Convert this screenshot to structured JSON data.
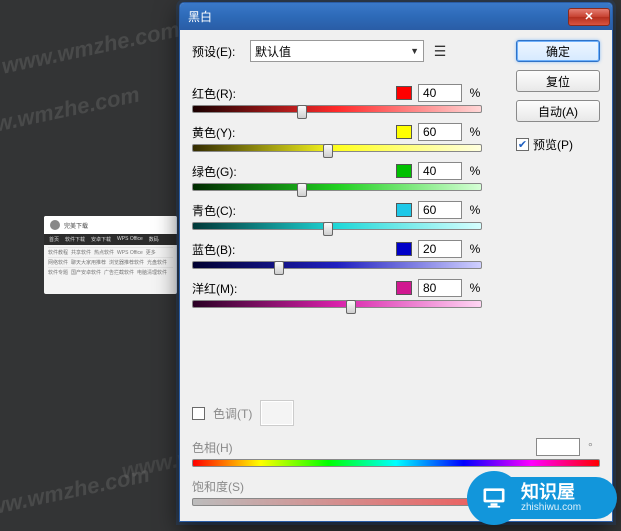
{
  "watermark": "www.wmzhe.com",
  "webpage": {
    "title": "完美下载",
    "tabs": [
      "首页",
      "软件下载",
      "安卓下载",
      "WPS Office",
      "数码"
    ],
    "rows": [
      [
        "软件教程",
        "共享软件",
        "热点软件",
        "WPS Office",
        "更多"
      ],
      [
        "网络软件",
        "聊天大家用推荐",
        "浏览器推荐软件",
        "光盘软件"
      ],
      [
        "软件专题",
        "国产安卓软件",
        "广告拦截软件",
        "电脑清理软件"
      ]
    ]
  },
  "dialog": {
    "title": "黑白",
    "preset_label": "预设(E):",
    "preset_value": "默认值",
    "buttons": {
      "ok": "确定",
      "reset": "复位",
      "auto": "自动(A)"
    },
    "preview_label": "预览(P)",
    "preview_checked": true,
    "colors": [
      {
        "key": "red",
        "label": "红色(R):",
        "swatch": "#ff0000",
        "value": "40",
        "thumbPct": 38
      },
      {
        "key": "yellow",
        "label": "黄色(Y):",
        "swatch": "#ffff00",
        "value": "60",
        "thumbPct": 47
      },
      {
        "key": "green",
        "label": "绿色(G):",
        "swatch": "#00c000",
        "value": "40",
        "thumbPct": 38
      },
      {
        "key": "cyan",
        "label": "青色(C):",
        "swatch": "#1ec8e8",
        "value": "60",
        "thumbPct": 47
      },
      {
        "key": "blue",
        "label": "蓝色(B):",
        "swatch": "#0000c8",
        "value": "20",
        "thumbPct": 30
      },
      {
        "key": "magenta",
        "label": "洋红(M):",
        "swatch": "#d01890",
        "value": "80",
        "thumbPct": 55
      }
    ],
    "percent_sign": "%",
    "tint": {
      "checkbox_label": "色调(T)",
      "checked": false,
      "hue_label": "色相(H)",
      "hue_value": "",
      "hue_unit": "°",
      "sat_label": "饱和度(S)",
      "sat_value": "",
      "sat_unit": "%"
    }
  },
  "badge": {
    "cn": "知识屋",
    "en": "zhishiwu.com"
  }
}
